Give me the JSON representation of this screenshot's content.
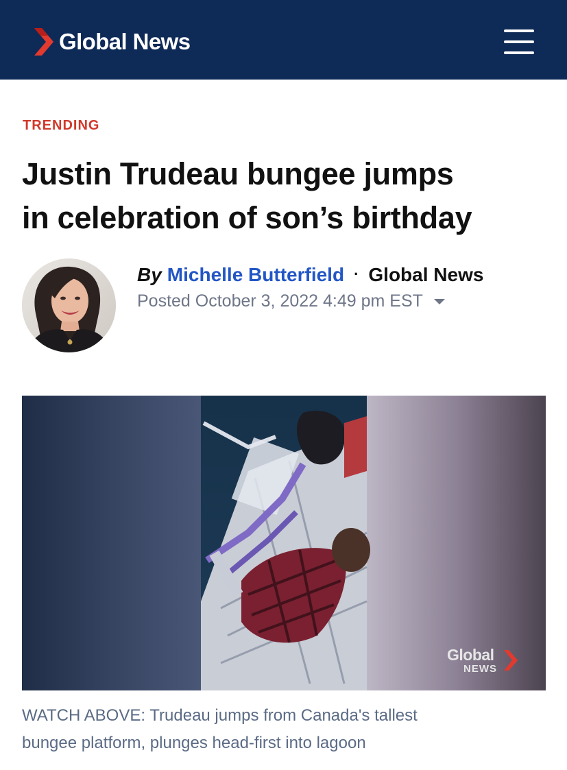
{
  "header": {
    "logo_text": "Global News",
    "menu_icon": "hamburger-menu-icon",
    "background_color": "#0e2a57",
    "brand_accent_color": "#e23a2f"
  },
  "article": {
    "kicker": "TRENDING",
    "kicker_color": "#d0392b",
    "headline_line1": "Justin Trudeau bungee jumps",
    "headline_line2": "in celebration of son’s birthday",
    "byline": {
      "prefix": "By",
      "author": "Michelle Butterfield",
      "author_color": "#2356c5",
      "separator": "·",
      "outlet": "Global News",
      "posted": "Posted October 3, 2022 4:49 pm EST",
      "posted_caret_icon": "chevron-down-icon"
    },
    "video": {
      "watermark_top": "Global",
      "watermark_bottom": "NEWS"
    },
    "caption_line1": "WATCH ABOVE: Trudeau jumps from Canada's tallest",
    "caption_line2": "bungee platform, plunges head-first into lagoon"
  }
}
